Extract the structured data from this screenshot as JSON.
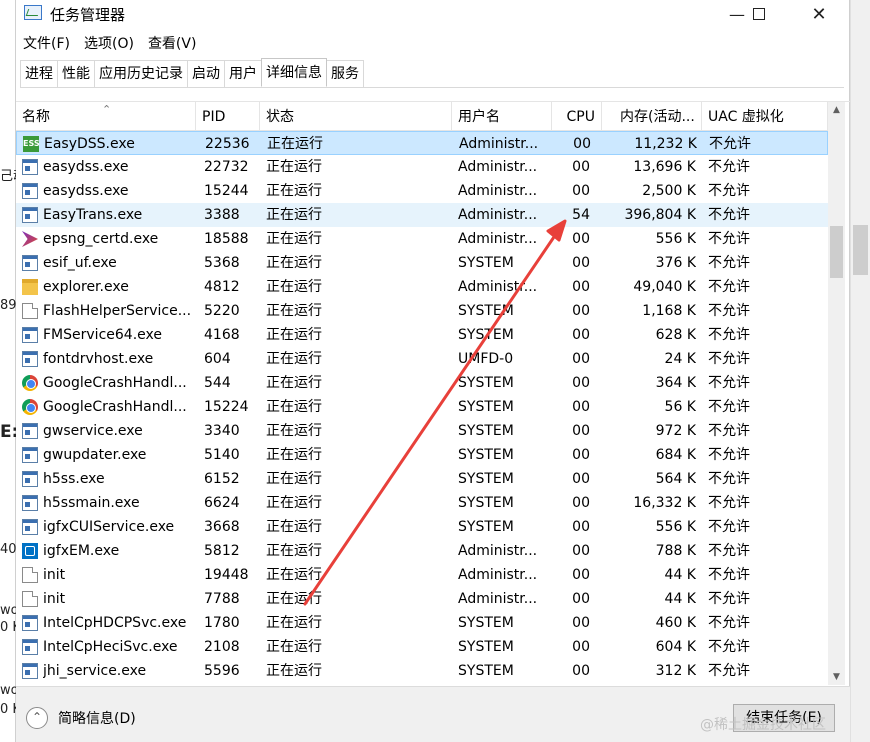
{
  "window": {
    "title": "任务管理器"
  },
  "background_fragments": [
    "己动",
    "89",
    "E:",
    "40.",
    "wo",
    "0 K",
    "wo",
    "0 K"
  ],
  "menu": [
    "文件(F)",
    "选项(O)",
    "查看(V)"
  ],
  "tabs": [
    {
      "label": "进程",
      "active": false
    },
    {
      "label": "性能",
      "active": false
    },
    {
      "label": "应用历史记录",
      "active": false
    },
    {
      "label": "启动",
      "active": false
    },
    {
      "label": "用户",
      "active": false
    },
    {
      "label": "详细信息",
      "active": true
    },
    {
      "label": "服务",
      "active": false
    }
  ],
  "columns": [
    "名称",
    "PID",
    "状态",
    "用户名",
    "CPU",
    "内存(活动...",
    "UAC 虚拟化"
  ],
  "rows": [
    {
      "icon": "easydss-icon",
      "name": "EasyDSS.exe",
      "pid": "22536",
      "status": "正在运行",
      "user": "Administr...",
      "cpu": "00",
      "mem": "11,232 K",
      "uac": "不允许",
      "selected": true
    },
    {
      "icon": "exe-icon",
      "name": "easydss.exe",
      "pid": "22732",
      "status": "正在运行",
      "user": "Administr...",
      "cpu": "00",
      "mem": "13,696 K",
      "uac": "不允许"
    },
    {
      "icon": "exe-icon",
      "name": "easydss.exe",
      "pid": "15244",
      "status": "正在运行",
      "user": "Administr...",
      "cpu": "00",
      "mem": "2,500 K",
      "uac": "不允许"
    },
    {
      "icon": "exe-icon",
      "name": "EasyTrans.exe",
      "pid": "3388",
      "status": "正在运行",
      "user": "Administr...",
      "cpu": "54",
      "mem": "396,804 K",
      "uac": "不允许",
      "highlight": true
    },
    {
      "icon": "epsng-icon",
      "name": "epsng_certd.exe",
      "pid": "18588",
      "status": "正在运行",
      "user": "Administr...",
      "cpu": "00",
      "mem": "556 K",
      "uac": "不允许"
    },
    {
      "icon": "exe-icon",
      "name": "esif_uf.exe",
      "pid": "5368",
      "status": "正在运行",
      "user": "SYSTEM",
      "cpu": "00",
      "mem": "376 K",
      "uac": "不允许"
    },
    {
      "icon": "folder-icon",
      "name": "explorer.exe",
      "pid": "4812",
      "status": "正在运行",
      "user": "Administr...",
      "cpu": "00",
      "mem": "49,040 K",
      "uac": "不允许"
    },
    {
      "icon": "doc-icon",
      "name": "FlashHelperService...",
      "pid": "5220",
      "status": "正在运行",
      "user": "SYSTEM",
      "cpu": "00",
      "mem": "1,168 K",
      "uac": "不允许"
    },
    {
      "icon": "exe-icon",
      "name": "FMService64.exe",
      "pid": "4168",
      "status": "正在运行",
      "user": "SYSTEM",
      "cpu": "00",
      "mem": "628 K",
      "uac": "不允许"
    },
    {
      "icon": "exe-icon",
      "name": "fontdrvhost.exe",
      "pid": "604",
      "status": "正在运行",
      "user": "UMFD-0",
      "cpu": "00",
      "mem": "24 K",
      "uac": "不允许"
    },
    {
      "icon": "chrome-icon",
      "name": "GoogleCrashHandl...",
      "pid": "544",
      "status": "正在运行",
      "user": "SYSTEM",
      "cpu": "00",
      "mem": "364 K",
      "uac": "不允许"
    },
    {
      "icon": "chrome-icon",
      "name": "GoogleCrashHandl...",
      "pid": "15224",
      "status": "正在运行",
      "user": "SYSTEM",
      "cpu": "00",
      "mem": "56 K",
      "uac": "不允许"
    },
    {
      "icon": "exe-icon",
      "name": "gwservice.exe",
      "pid": "3340",
      "status": "正在运行",
      "user": "SYSTEM",
      "cpu": "00",
      "mem": "972 K",
      "uac": "不允许"
    },
    {
      "icon": "exe-icon",
      "name": "gwupdater.exe",
      "pid": "5140",
      "status": "正在运行",
      "user": "SYSTEM",
      "cpu": "00",
      "mem": "684 K",
      "uac": "不允许"
    },
    {
      "icon": "exe-icon",
      "name": "h5ss.exe",
      "pid": "6152",
      "status": "正在运行",
      "user": "SYSTEM",
      "cpu": "00",
      "mem": "564 K",
      "uac": "不允许"
    },
    {
      "icon": "exe-icon",
      "name": "h5ssmain.exe",
      "pid": "6624",
      "status": "正在运行",
      "user": "SYSTEM",
      "cpu": "00",
      "mem": "16,332 K",
      "uac": "不允许"
    },
    {
      "icon": "exe-icon",
      "name": "igfxCUIService.exe",
      "pid": "3668",
      "status": "正在运行",
      "user": "SYSTEM",
      "cpu": "00",
      "mem": "556 K",
      "uac": "不允许"
    },
    {
      "icon": "intel-icon",
      "name": "igfxEM.exe",
      "pid": "5812",
      "status": "正在运行",
      "user": "Administr...",
      "cpu": "00",
      "mem": "788 K",
      "uac": "不允许"
    },
    {
      "icon": "doc-icon",
      "name": "init",
      "pid": "19448",
      "status": "正在运行",
      "user": "Administr...",
      "cpu": "00",
      "mem": "44 K",
      "uac": "不允许"
    },
    {
      "icon": "doc-icon",
      "name": "init",
      "pid": "7788",
      "status": "正在运行",
      "user": "Administr...",
      "cpu": "00",
      "mem": "44 K",
      "uac": "不允许"
    },
    {
      "icon": "exe-icon",
      "name": "IntelCpHDCPSvc.exe",
      "pid": "1780",
      "status": "正在运行",
      "user": "SYSTEM",
      "cpu": "00",
      "mem": "460 K",
      "uac": "不允许"
    },
    {
      "icon": "exe-icon",
      "name": "IntelCpHeciSvc.exe",
      "pid": "2108",
      "status": "正在运行",
      "user": "SYSTEM",
      "cpu": "00",
      "mem": "604 K",
      "uac": "不允许"
    },
    {
      "icon": "exe-icon",
      "name": "jhi_service.exe",
      "pid": "5596",
      "status": "正在运行",
      "user": "SYSTEM",
      "cpu": "00",
      "mem": "312 K",
      "uac": "不允许"
    }
  ],
  "footer": {
    "fewer_details": "简略信息(D)",
    "end_task": "结束任务(E)"
  },
  "watermark": "@稀土掘金技术社区",
  "colors": {
    "selected_row": "#cce8ff",
    "annotation_arrow": "#e8403a"
  }
}
